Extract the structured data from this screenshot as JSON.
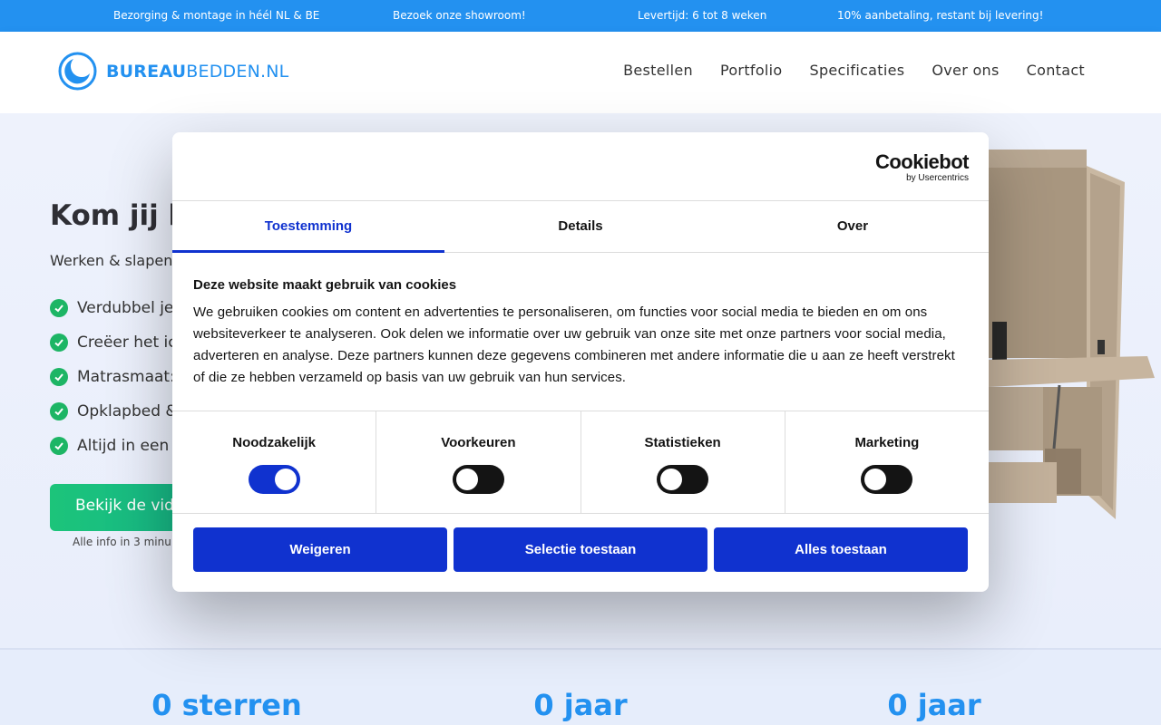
{
  "topbar": {
    "items": [
      "Bezorging & montage in héél NL & BE",
      "Bezoek onze showroom!",
      "Levertijd: 6 tot 8 weken",
      "10% aanbetaling, restant bij levering!"
    ]
  },
  "header": {
    "logo_bold": "BUREAU",
    "logo_rest": "BEDDEN.NL",
    "nav": [
      "Bestellen",
      "Portfolio",
      "Specificaties",
      "Over ons",
      "Contact"
    ]
  },
  "hero": {
    "title": "Kom jij k",
    "subtitle": "Werken & slapen",
    "features": [
      "Verdubbel je",
      "Creëer het ic",
      "Matrasmaat:",
      "Opklapbed &",
      "Altijd in een"
    ],
    "cta": "Bekijk de vide",
    "cta_note": "Alle info in 3 minu"
  },
  "stats": [
    "0 sterren",
    "0 jaar",
    "0 jaar"
  ],
  "cookie": {
    "brand": "Cookiebot",
    "brand_sub": "by Usercentrics",
    "tabs": [
      "Toestemming",
      "Details",
      "Over"
    ],
    "title": "Deze website maakt gebruik van cookies",
    "text": "We gebruiken cookies om content en advertenties te personaliseren, om functies voor social media te bieden en om ons websiteverkeer te analyseren. Ook delen we informatie over uw gebruik van onze site met onze partners voor social media, adverteren en analyse. Deze partners kunnen deze gegevens combineren met andere informatie die u aan ze heeft verstrekt of die ze hebben verzameld op basis van uw gebruik van hun services.",
    "toggles": [
      {
        "label": "Noodzakelijk",
        "on": true
      },
      {
        "label": "Voorkeuren",
        "on": false
      },
      {
        "label": "Statistieken",
        "on": false
      },
      {
        "label": "Marketing",
        "on": false
      }
    ],
    "buttons": [
      "Weigeren",
      "Selectie toestaan",
      "Alles toestaan"
    ]
  },
  "colors": {
    "topbar": "#2391f0",
    "cookie_primary": "#1032cf",
    "check_green": "#1db565",
    "stat_blue": "#2391f0"
  }
}
